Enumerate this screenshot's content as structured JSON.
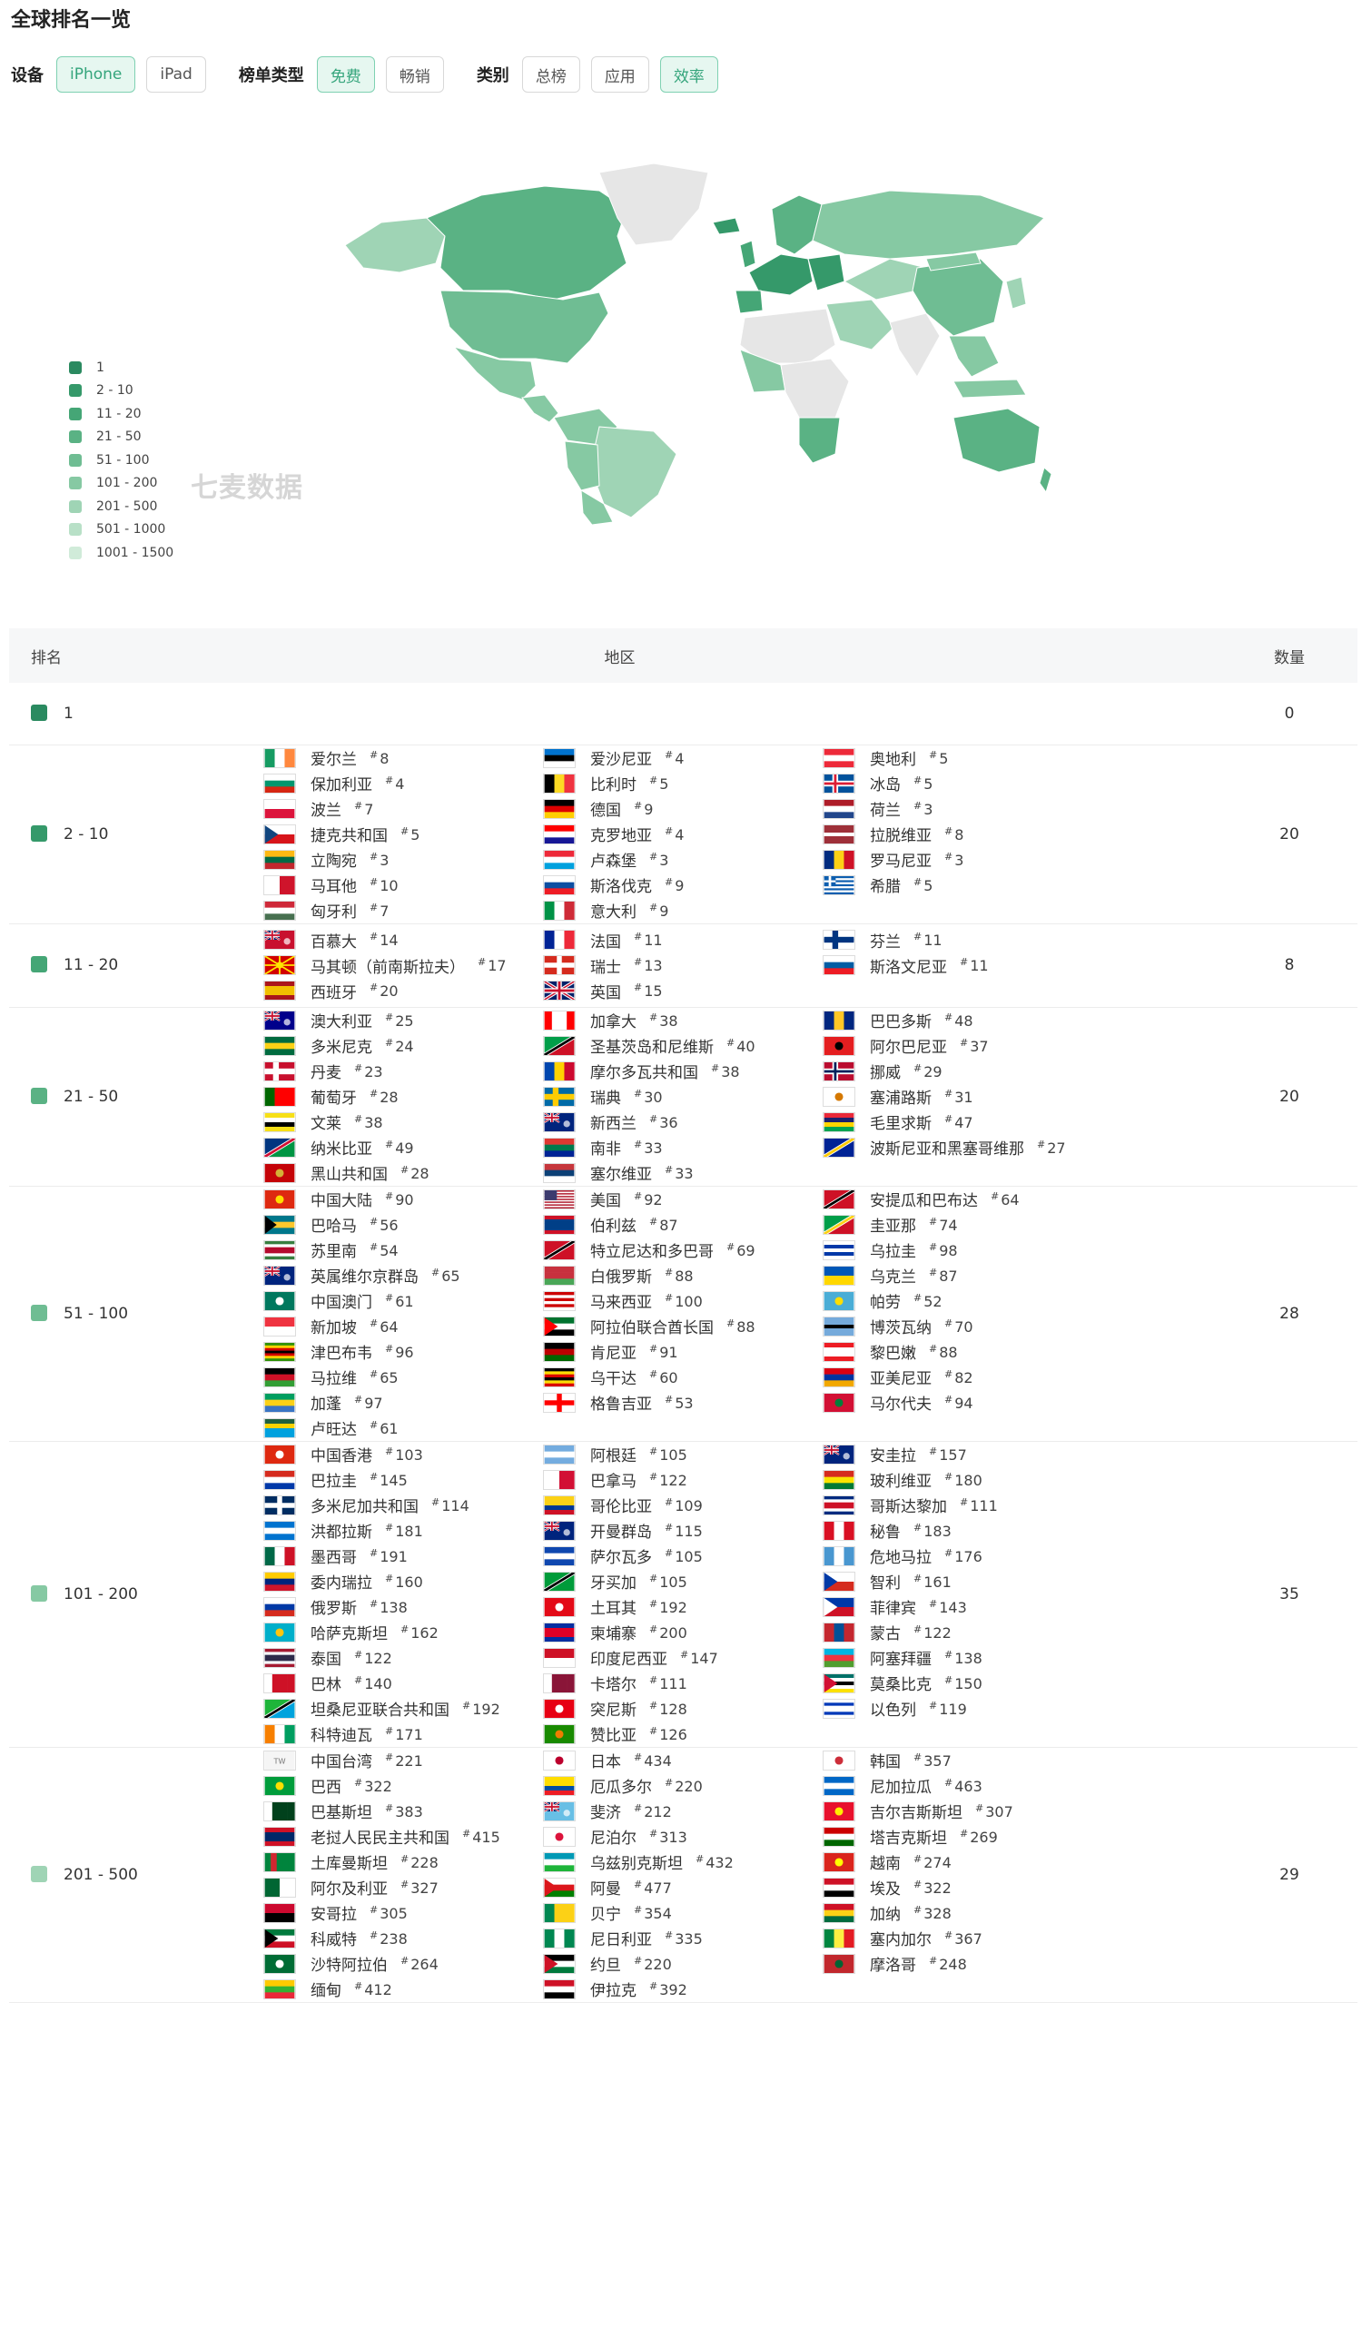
{
  "title": "全球排名一览",
  "filters": {
    "device_label": "设备",
    "devices": [
      {
        "label": "iPhone",
        "active": true
      },
      {
        "label": "iPad",
        "active": false
      }
    ],
    "chart_type_label": "榜单类型",
    "chart_types": [
      {
        "label": "免费",
        "active": true
      },
      {
        "label": "畅销",
        "active": false
      }
    ],
    "category_label": "类别",
    "categories": [
      {
        "label": "总榜",
        "active": false
      },
      {
        "label": "应用",
        "active": false
      },
      {
        "label": "效率",
        "active": true
      }
    ]
  },
  "watermark": "七麦数据",
  "legend": [
    {
      "label": "1",
      "color": "#2a8a60"
    },
    {
      "label": "2 - 10",
      "color": "#35996a"
    },
    {
      "label": "11 - 20",
      "color": "#45a676"
    },
    {
      "label": "21 - 50",
      "color": "#5ab284"
    },
    {
      "label": "51 - 100",
      "color": "#6fbd93"
    },
    {
      "label": "101 - 200",
      "color": "#86c9a3"
    },
    {
      "label": "201 - 500",
      "color": "#9fd4b5"
    },
    {
      "label": "501 - 1000",
      "color": "#b8e0c7"
    },
    {
      "label": "1001 - 1500",
      "color": "#d0ebd9"
    }
  ],
  "table": {
    "headers": {
      "rank": "排名",
      "region": "地区",
      "count": "数量"
    },
    "rows": [
      {
        "range": "1",
        "color": "#2a8a60",
        "count": "0",
        "columns": [
          [],
          [],
          []
        ]
      },
      {
        "range": "2 - 10",
        "color": "#35996a",
        "count": "20",
        "columns": [
          [
            [
              "爱尔兰",
              "8"
            ],
            [
              "保加利亚",
              "4"
            ],
            [
              "波兰",
              "7"
            ],
            [
              "捷克共和国",
              "5"
            ],
            [
              "立陶宛",
              "3"
            ],
            [
              "马耳他",
              "10"
            ],
            [
              "匈牙利",
              "7"
            ]
          ],
          [
            [
              "爱沙尼亚",
              "4"
            ],
            [
              "比利时",
              "5"
            ],
            [
              "德国",
              "9"
            ],
            [
              "克罗地亚",
              "4"
            ],
            [
              "卢森堡",
              "3"
            ],
            [
              "斯洛伐克",
              "9"
            ],
            [
              "意大利",
              "9"
            ]
          ],
          [
            [
              "奥地利",
              "5"
            ],
            [
              "冰岛",
              "5"
            ],
            [
              "荷兰",
              "3"
            ],
            [
              "拉脱维亚",
              "8"
            ],
            [
              "罗马尼亚",
              "3"
            ],
            [
              "希腊",
              "5"
            ]
          ]
        ]
      },
      {
        "range": "11 - 20",
        "color": "#45a676",
        "count": "8",
        "columns": [
          [
            [
              "百慕大",
              "14"
            ],
            [
              "马其顿（前南斯拉夫）",
              "17"
            ],
            [
              "西班牙",
              "20"
            ]
          ],
          [
            [
              "法国",
              "11"
            ],
            [
              "瑞士",
              "13"
            ],
            [
              "英国",
              "15"
            ]
          ],
          [
            [
              "芬兰",
              "11"
            ],
            [
              "斯洛文尼亚",
              "11"
            ]
          ]
        ]
      },
      {
        "range": "21 - 50",
        "color": "#5ab284",
        "count": "20",
        "columns": [
          [
            [
              "澳大利亚",
              "25"
            ],
            [
              "多米尼克",
              "24"
            ],
            [
              "丹麦",
              "23"
            ],
            [
              "葡萄牙",
              "28"
            ],
            [
              "文莱",
              "38"
            ],
            [
              "纳米比亚",
              "49"
            ],
            [
              "黑山共和国",
              "28"
            ]
          ],
          [
            [
              "加拿大",
              "38"
            ],
            [
              "圣基茨岛和尼维斯",
              "40"
            ],
            [
              "摩尔多瓦共和国",
              "38"
            ],
            [
              "瑞典",
              "30"
            ],
            [
              "新西兰",
              "36"
            ],
            [
              "南非",
              "33"
            ],
            [
              "塞尔维亚",
              "33"
            ]
          ],
          [
            [
              "巴巴多斯",
              "48"
            ],
            [
              "阿尔巴尼亚",
              "37"
            ],
            [
              "挪威",
              "29"
            ],
            [
              "塞浦路斯",
              "31"
            ],
            [
              "毛里求斯",
              "47"
            ],
            [
              "波斯尼亚和黑塞哥维那",
              "27"
            ]
          ]
        ]
      },
      {
        "range": "51 - 100",
        "color": "#6fbd93",
        "count": "28",
        "columns": [
          [
            [
              "中国大陆",
              "90"
            ],
            [
              "巴哈马",
              "56"
            ],
            [
              "苏里南",
              "54"
            ],
            [
              "英属维尔京群岛",
              "65"
            ],
            [
              "中国澳门",
              "61"
            ],
            [
              "新加坡",
              "64"
            ],
            [
              "津巴布韦",
              "96"
            ],
            [
              "马拉维",
              "65"
            ],
            [
              "加蓬",
              "97"
            ],
            [
              "卢旺达",
              "61"
            ]
          ],
          [
            [
              "美国",
              "92"
            ],
            [
              "伯利兹",
              "87"
            ],
            [
              "特立尼达和多巴哥",
              "69"
            ],
            [
              "白俄罗斯",
              "88"
            ],
            [
              "马来西亚",
              "100"
            ],
            [
              "阿拉伯联合酋长国",
              "88"
            ],
            [
              "肯尼亚",
              "91"
            ],
            [
              "乌干达",
              "60"
            ],
            [
              "格鲁吉亚",
              "53"
            ]
          ],
          [
            [
              "安提瓜和巴布达",
              "64"
            ],
            [
              "圭亚那",
              "74"
            ],
            [
              "乌拉圭",
              "98"
            ],
            [
              "乌克兰",
              "87"
            ],
            [
              "帕劳",
              "52"
            ],
            [
              "博茨瓦纳",
              "70"
            ],
            [
              "黎巴嫩",
              "88"
            ],
            [
              "亚美尼亚",
              "82"
            ],
            [
              "马尔代夫",
              "94"
            ]
          ]
        ]
      },
      {
        "range": "101 - 200",
        "color": "#86c9a3",
        "count": "35",
        "columns": [
          [
            [
              "中国香港",
              "103"
            ],
            [
              "巴拉圭",
              "145"
            ],
            [
              "多米尼加共和国",
              "114"
            ],
            [
              "洪都拉斯",
              "181"
            ],
            [
              "墨西哥",
              "191"
            ],
            [
              "委内瑞拉",
              "160"
            ],
            [
              "俄罗斯",
              "138"
            ],
            [
              "哈萨克斯坦",
              "162"
            ],
            [
              "泰国",
              "122"
            ],
            [
              "巴林",
              "140"
            ],
            [
              "坦桑尼亚联合共和国",
              "192"
            ],
            [
              "科特迪瓦",
              "171"
            ]
          ],
          [
            [
              "阿根廷",
              "105"
            ],
            [
              "巴拿马",
              "122"
            ],
            [
              "哥伦比亚",
              "109"
            ],
            [
              "开曼群岛",
              "115"
            ],
            [
              "萨尔瓦多",
              "105"
            ],
            [
              "牙买加",
              "105"
            ],
            [
              "土耳其",
              "192"
            ],
            [
              "柬埔寨",
              "200"
            ],
            [
              "印度尼西亚",
              "147"
            ],
            [
              "卡塔尔",
              "111"
            ],
            [
              "突尼斯",
              "128"
            ],
            [
              "赞比亚",
              "126"
            ]
          ],
          [
            [
              "安圭拉",
              "157"
            ],
            [
              "玻利维亚",
              "180"
            ],
            [
              "哥斯达黎加",
              "111"
            ],
            [
              "秘鲁",
              "183"
            ],
            [
              "危地马拉",
              "176"
            ],
            [
              "智利",
              "161"
            ],
            [
              "菲律宾",
              "143"
            ],
            [
              "蒙古",
              "122"
            ],
            [
              "阿塞拜疆",
              "138"
            ],
            [
              "莫桑比克",
              "150"
            ],
            [
              "以色列",
              "119"
            ]
          ]
        ]
      },
      {
        "range": "201 - 500",
        "color": "#9fd4b5",
        "count": "29",
        "columns": [
          [
            [
              "中国台湾",
              "221"
            ],
            [
              "巴西",
              "322"
            ],
            [
              "巴基斯坦",
              "383"
            ],
            [
              "老挝人民民主共和国",
              "415"
            ],
            [
              "土库曼斯坦",
              "228"
            ],
            [
              "阿尔及利亚",
              "327"
            ],
            [
              "安哥拉",
              "305"
            ],
            [
              "科威特",
              "238"
            ],
            [
              "沙特阿拉伯",
              "264"
            ],
            [
              "缅甸",
              "412"
            ]
          ],
          [
            [
              "日本",
              "434"
            ],
            [
              "厄瓜多尔",
              "220"
            ],
            [
              "斐济",
              "212"
            ],
            [
              "尼泊尔",
              "313"
            ],
            [
              "乌兹别克斯坦",
              "432"
            ],
            [
              "阿曼",
              "477"
            ],
            [
              "贝宁",
              "354"
            ],
            [
              "尼日利亚",
              "335"
            ],
            [
              "约旦",
              "220"
            ],
            [
              "伊拉克",
              "392"
            ]
          ],
          [
            [
              "韩国",
              "357"
            ],
            [
              "尼加拉瓜",
              "463"
            ],
            [
              "吉尔吉斯斯坦",
              "307"
            ],
            [
              "塔吉克斯坦",
              "269"
            ],
            [
              "越南",
              "274"
            ],
            [
              "埃及",
              "322"
            ],
            [
              "加纳",
              "328"
            ],
            [
              "塞内加尔",
              "367"
            ],
            [
              "摩洛哥",
              "248"
            ]
          ]
        ]
      }
    ]
  },
  "flags": {
    "爱尔兰": "v:#169b62,#ffffff,#ff883e",
    "保加利亚": "h:#ffffff,#00966e,#d62612",
    "波兰": "h:#ffffff,#dc143c",
    "捷克共和国": "h:#ffffff,#d7141a|t:#11457e",
    "立陶宛": "h:#fdb913,#006a44,#c1272d",
    "马耳他": "v:#ffffff,#cf142b",
    "匈牙利": "h:#ce2939,#ffffff,#477050",
    "爱沙尼亚": "h:#0072ce,#000000,#ffffff",
    "比利时": "v:#000000,#fdda24,#ef3340",
    "德国": "h:#000000,#dd0000,#ffce00",
    "克罗地亚": "h:#ff0000,#ffffff,#171796",
    "卢森堡": "h:#ed2939,#ffffff,#00a1de",
    "斯洛伐克": "h:#ffffff,#0b4ea2,#ee1c25",
    "意大利": "v:#009246,#ffffff,#ce2b37",
    "奥地利": "h:#ed2939,#ffffff,#ed2939",
    "冰岛": "c:#02529c,#ffffff,#dc1e35",
    "荷兰": "h:#ae1c28,#ffffff,#21468b",
    "拉脱维亚": "h:#9e3039,#9e3039,#ffffff,#9e3039,#9e3039",
    "罗马尼亚": "v:#002b7f,#fcd116,#ce1126",
    "希腊": "s:#0d5eaf,#ffffff",
    "百慕大": "b:#c8102e",
    "马其顿（前南斯拉夫）": "r:#d20000,#ffe600",
    "西班牙": "h:#aa151b,#f1bf00,#f1bf00,#aa151b",
    "法国": "v:#002395,#ffffff,#ed2939",
    "瑞士": "x:#d52b1e",
    "英国": "u:#012169",
    "芬兰": "c:#ffffff,#003580,#003580",
    "斯洛文尼亚": "h:#ffffff,#005da4,#ed1c24",
    "澳大利亚": "b:#00008b",
    "多米尼克": "h:#006b3f,#fcd116,#006b3f",
    "丹麦": "c:#c8102e,#ffffff,#ffffff",
    "葡萄牙": "v:#006600,#ff0000,#ff0000",
    "文莱": "h:#f7e017,#ffffff,#000000,#f7e017",
    "纳米比亚": "d:#003580,#d21034,#009543",
    "黑山共和国": "f:#c40308,#d4af37",
    "加拿大": "v:#ff0000,#ffffff,#ffffff,#ff0000",
    "圣基茨岛和尼维斯": "d:#009e49,#000000,#ce1126",
    "摩尔多瓦共和国": "v:#0046ae,#ffd200,#cc092f",
    "瑞典": "c:#006aa7,#fecc02,#fecc02",
    "新西兰": "b:#00247d",
    "南非": "h:#de3831,#007a4d,#002395",
    "塞尔维亚": "h:#c6363c,#0c4076,#ffffff",
    "巴巴多斯": "v:#00267f,#ffc726,#00267f",
    "阿尔巴尼亚": "f:#e41e20,#000000",
    "挪威": "c:#ba0c2f,#ffffff,#00205b",
    "塞浦路斯": "f:#ffffff,#d57800",
    "毛里求斯": "h:#ea2839,#1a206d,#ffd500,#00a551",
    "波斯尼亚和黑塞哥维那": "d:#002395,#fecb00,#002395",
    "中国大陆": "f:#de2910,#ffde00",
    "巴哈马": "t2:#00778b,#ffc72c,#00778b",
    "苏里南": "h:#377e3f,#ffffff,#b40a2d,#b40a2d,#ffffff,#377e3f",
    "英属维尔京群岛": "b:#00247d",
    "中国澳门": "f:#00785e,#ffffff",
    "新加坡": "h:#ef3340,#ffffff",
    "津巴布韦": "h:#319208,#ffd200,#d40000,#000000,#d40000,#ffd200,#319208",
    "马拉维": "h:#000000,#ce1126,#339e35",
    "加蓬": "h:#009e60,#fcd116,#3a75c4",
    "卢旺达": "h:#20603d,#fad201,#00a1de,#00a1de",
    "美国": "us:#b22234",
    "伯利兹": "h:#ce1126,#003f87,#003f87,#003f87,#ce1126",
    "特立尼达和多巴哥": "d:#ce1126,#000000,#ce1126",
    "白俄罗斯": "h:#c8313e,#c8313e,#4aa657",
    "马来西亚": "h:#cc0001,#ffffff,#cc0001,#ffffff,#cc0001,#ffffff",
    "阿拉伯联合酋长国": "h:#00732f,#ffffff,#000000|t:#ff0000",
    "肯尼亚": "h:#000000,#bb0000,#006600",
    "乌干达": "h:#000000,#fcdc04,#d90000,#000000,#fcdc04,#d90000",
    "格鲁吉亚": "x:#ffffff",
    "安提瓜和巴布达": "d:#ce1126,#000000,#ce1126",
    "圭亚那": "d:#009e49,#fcd116,#ce1126",
    "乌拉圭": "h:#ffffff,#0038a8,#ffffff,#0038a8,#ffffff",
    "乌克兰": "h:#0057b7,#ffd700",
    "帕劳": "f:#4aadd6,#ffde00",
    "博茨瓦纳": "h:#75aadb,#75aadb,#000000,#75aadb,#75aadb",
    "黎巴嫩": "h:#ed1c24,#ffffff,#ffffff,#ed1c24",
    "亚美尼亚": "h:#d90012,#0033a0,#f2a800",
    "马尔代夫": "f:#d21034,#007e3a",
    "中国香港": "f:#de2910,#ffffff",
    "巴拉圭": "h:#d52b1e,#ffffff,#0038a8",
    "多米尼加共和国": "x:#002d62",
    "洪都拉斯": "h:#0073cf,#ffffff,#0073cf",
    "墨西哥": "v:#006847,#ffffff,#ce1126",
    "委内瑞拉": "h:#ffcc00,#00247d,#cf142b",
    "俄罗斯": "h:#ffffff,#0039a6,#d52b1e",
    "哈萨克斯坦": "f:#00afca,#fec50c",
    "泰国": "h:#a51931,#f4f5f8,#2d2a4a,#2d2a4a,#f4f5f8,#a51931",
    "巴林": "v:#ffffff,#ce1126,#ce1126,#ce1126",
    "坦桑尼亚联合共和国": "d:#1eb53a,#000000,#00a3dd",
    "科特迪瓦": "v:#f77f00,#ffffff,#009e60",
    "阿根廷": "h:#74acdf,#ffffff,#74acdf",
    "巴拿马": "v:#ffffff,#d21034",
    "哥伦比亚": "h:#fcd116,#fcd116,#003893,#ce1126",
    "开曼群岛": "b:#00247d",
    "萨尔瓦多": "h:#0f47af,#ffffff,#0f47af",
    "牙买加": "d:#009b3a,#000000,#009b3a",
    "土耳其": "f:#e30a17,#ffffff",
    "柬埔寨": "h:#032ea1,#e00025,#e00025,#032ea1",
    "印度尼西亚": "h:#ce1126,#ffffff",
    "卡塔尔": "v:#ffffff,#8a1538,#8a1538,#8a1538",
    "突尼斯": "f:#e70013,#ffffff",
    "赞比亚": "f:#198a00,#ef7d00",
    "安圭拉": "b:#00247d",
    "玻利维亚": "h:#d52b1e,#f9e300,#007934",
    "哥斯达黎加": "h:#002b7f,#ffffff,#ce1126,#ce1126,#ffffff,#002b7f",
    "秘鲁": "v:#d91023,#ffffff,#d91023",
    "危地马拉": "v:#4997d0,#ffffff,#4997d0",
    "智利": "h:#ffffff,#d52b1e|t:#0039a6",
    "菲律宾": "h:#0038a8,#ce1126|t:#ffffff",
    "蒙古": "v:#c4272f,#015197,#c4272f",
    "阿塞拜疆": "h:#00b5e2,#ef3340,#509e2f",
    "莫桑比克": "h:#007168,#ffffff,#000000,#ffffff,#fce100|t:#d21034",
    "以色列": "h:#ffffff,#0038b8,#ffffff,#ffffff,#0038b8,#ffffff",
    "中国台湾": "tw:#f5f5f5",
    "巴西": "f:#009c3b,#ffdf00",
    "巴基斯坦": "v:#ffffff,#01411c,#01411c,#01411c",
    "老挝人民民主共和国": "h:#ce1126,#002868,#002868,#ce1126",
    "土库曼斯坦": "v:#00843d,#d22630,#00843d,#00843d,#00843d",
    "阿尔及利亚": "v:#006633,#ffffff",
    "安哥拉": "h:#cc092f,#000000",
    "科威特": "h:#007a3d,#ffffff,#ce1126|t:#000000",
    "沙特阿拉伯": "f:#006c35,#ffffff",
    "缅甸": "h:#fecb00,#34b233,#ea2839",
    "日本": "f:#ffffff,#bc002d",
    "厄瓜多尔": "h:#ffdd00,#ffdd00,#034ea2,#ed1c24",
    "斐济": "b:#68bfe5",
    "尼泊尔": "f:#ffffff,#dc143c",
    "乌兹别克斯坦": "h:#0099b5,#ffffff,#1eb53a",
    "阿曼": "h:#ffffff,#db161b,#008000|t:#db161b",
    "贝宁": "v:#008751,#fcd116,#fcd116",
    "尼日利亚": "v:#008751,#ffffff,#008751",
    "约旦": "h:#000000,#ffffff,#007a3d|t:#ce1126",
    "伊拉克": "h:#ce1126,#ffffff,#000000",
    "韩国": "f:#ffffff,#cd2e3a",
    "尼加拉瓜": "h:#0067c6,#ffffff,#0067c6",
    "吉尔吉斯斯坦": "f:#e8112d,#ffef00",
    "塔吉克斯坦": "h:#cc0000,#ffffff,#006600",
    "越南": "f:#da251d,#ffff00",
    "埃及": "h:#ce1126,#ffffff,#000000",
    "加纳": "h:#ce1126,#fcd116,#006b3f",
    "塞内加尔": "v:#00853f,#fdef42,#e31b23",
    "摩洛哥": "f:#c1272d,#006233"
  }
}
